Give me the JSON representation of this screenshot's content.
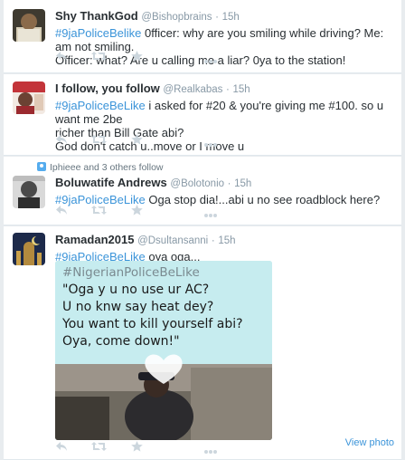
{
  "tweets": [
    {
      "fullname": "Shy ThankGod",
      "handle": "@Bishopbrains",
      "time": "15h",
      "hashtag": "#9jaPoliceBelike",
      "lines": [
        " 0fficer: why are you smiling while driving? Me: am not smiling.",
        "Officer: what? Are u calling me a liar? 0ya to the station!"
      ]
    },
    {
      "fullname": "I follow, you follow",
      "handle": "@Realkabas",
      "time": "15h",
      "hashtag": "#9jaPoliceBeLike",
      "lines": [
        " i asked for #20 & you're giving me #100. so u want me 2be",
        "richer than Bill Gate abi?",
        "God don't catch u..move or I move u"
      ]
    },
    {
      "social": "Iphieee and 3 others follow",
      "fullname": "Boluwatife Andrews",
      "handle": "@Bolotonio",
      "time": "15h",
      "hashtag": "#9jaPoliceBeLike",
      "lines": [
        " Oga stop dia!...abi u no see roadblock here?"
      ]
    },
    {
      "fullname": "Ramadan2015",
      "handle": "@Dsultansanni",
      "time": "15h",
      "hashtag": "#9jaPoliceBeLike",
      "lines": [
        " oya oga..."
      ],
      "media": {
        "hashtag": "#NigerianPoliceBeLike",
        "lines": [
          "\"Oga y u no use ur AC?",
          "U no knw say heat dey?",
          "You want to kill yourself abi?",
          "Oya, come down!\""
        ]
      },
      "view_photo": "View photo"
    }
  ],
  "separator": "·",
  "icons": [
    "reply-icon",
    "retweet-icon",
    "favorite-icon",
    "more-icon"
  ],
  "colors": {
    "link": "#3b94d9",
    "action_icon": "#ccd6dd",
    "meta": "#8899a6"
  }
}
